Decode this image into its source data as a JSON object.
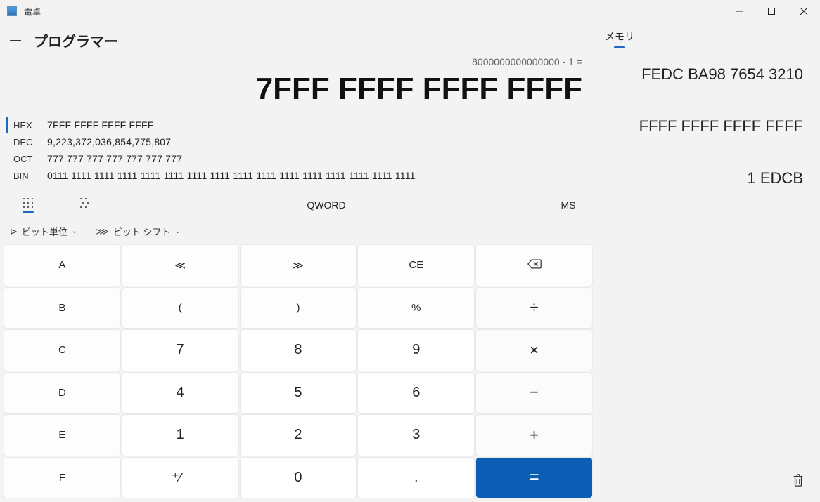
{
  "app": {
    "title": "電卓"
  },
  "mode_title": "プログラマー",
  "display": {
    "expression": "8000000000000000 - 1 =",
    "result": "7FFF FFFF FFFF FFFF"
  },
  "radix": {
    "hex": {
      "label": "HEX",
      "value": "7FFF FFFF FFFF FFFF"
    },
    "dec": {
      "label": "DEC",
      "value": "9,223,372,036,854,775,807"
    },
    "oct": {
      "label": "OCT",
      "value": "777 777 777 777 777 777 777"
    },
    "bin": {
      "label": "BIN",
      "value": "0111 1111 1111 1111 1111 1111 1111 1111 1111 1111 1111 1111 1111 1111 1111 1111"
    }
  },
  "word_size": "QWORD",
  "ms_label": "MS",
  "options": {
    "bitwise": "ビット単位",
    "bitshift": "ビット シフト"
  },
  "keys": {
    "A": "A",
    "B": "B",
    "C": "C",
    "D": "D",
    "E": "E",
    "F": "F",
    "lsh": "≪",
    "rsh": "≫",
    "CE": "CE",
    "lpar": "(",
    "rpar": ")",
    "pct": "%",
    "div": "÷",
    "7": "7",
    "8": "8",
    "9": "9",
    "mul": "×",
    "4": "4",
    "5": "5",
    "6": "6",
    "sub": "−",
    "1": "1",
    "2": "2",
    "3": "3",
    "add": "+",
    "pm": "⁺∕₋",
    "0": "0",
    "dot": ".",
    "eq": "="
  },
  "memory": {
    "tab_label": "メモリ",
    "items": [
      "FEDC BA98 7654 3210",
      "FFFF FFFF FFFF FFFF",
      "1 EDCB"
    ]
  }
}
